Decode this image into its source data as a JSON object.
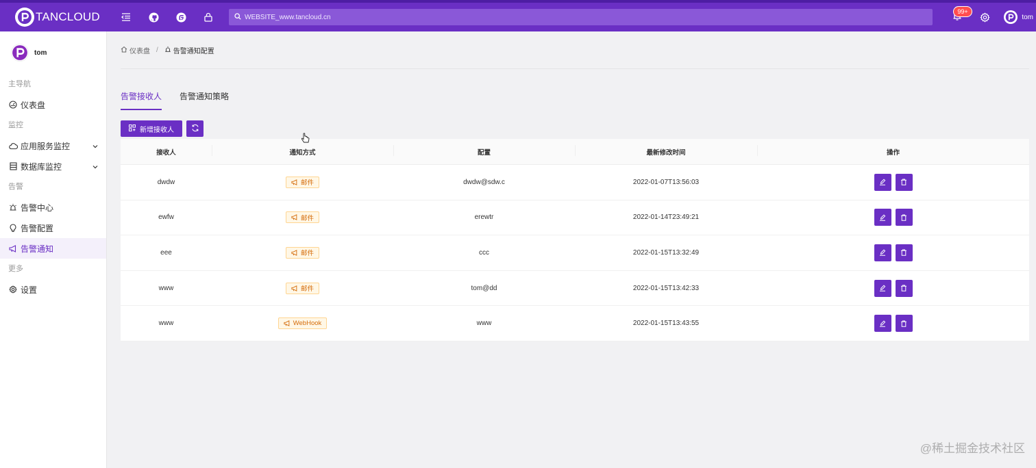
{
  "header": {
    "brand": "TANCLOUD",
    "search_placeholder": "WEBSITE_www.tancloud.cn",
    "notification_badge": "99+",
    "user": "tom",
    "icons": [
      "menu-fold-icon",
      "github-icon",
      "gitee-icon",
      "lock-icon",
      "bell-icon",
      "gear-icon"
    ]
  },
  "sidebar": {
    "user": "tom",
    "groups": [
      {
        "title": "主导航",
        "items": [
          {
            "label": "仪表盘",
            "icon": "dashboard-icon"
          }
        ]
      },
      {
        "title": "监控",
        "items": [
          {
            "label": "应用服务监控",
            "icon": "cloud-icon",
            "expandable": true
          },
          {
            "label": "数据库监控",
            "icon": "database-icon",
            "expandable": true
          }
        ]
      },
      {
        "title": "告警",
        "items": [
          {
            "label": "告警中心",
            "icon": "alarm-icon"
          },
          {
            "label": "告警配置",
            "icon": "bulb-icon"
          },
          {
            "label": "告警通知",
            "icon": "notification-icon",
            "active": true
          }
        ]
      },
      {
        "title": "更多",
        "items": [
          {
            "label": "设置",
            "icon": "gear-icon"
          }
        ]
      }
    ]
  },
  "breadcrumb": {
    "home": "仪表盘",
    "current": "告警通知配置"
  },
  "tabs": [
    {
      "label": "告警接收人",
      "active": true
    },
    {
      "label": "告警通知策略",
      "active": false
    }
  ],
  "toolbar": {
    "add_label": "新增接收人"
  },
  "table": {
    "columns": [
      "接收人",
      "通知方式",
      "配置",
      "最新修改时间",
      "操作"
    ],
    "rows": [
      {
        "name": "dwdw",
        "method": "邮件",
        "config": "dwdw@sdw.c",
        "modified": "2022-01-07T13:56:03"
      },
      {
        "name": "ewfw",
        "method": "邮件",
        "config": "erewtr",
        "modified": "2022-01-14T23:49:21"
      },
      {
        "name": "eee",
        "method": "邮件",
        "config": "ccc",
        "modified": "2022-01-15T13:32:49"
      },
      {
        "name": "www",
        "method": "邮件",
        "config": "tom@dd",
        "modified": "2022-01-15T13:42:33"
      },
      {
        "name": "www",
        "method": "WebHook",
        "config": "www",
        "modified": "2022-01-15T13:43:55"
      }
    ]
  },
  "watermark": "@稀土掘金技术社区",
  "colors": {
    "primary": "#6a2fc4",
    "tag_text": "#d46b08",
    "tag_bg": "#fff7e6"
  }
}
